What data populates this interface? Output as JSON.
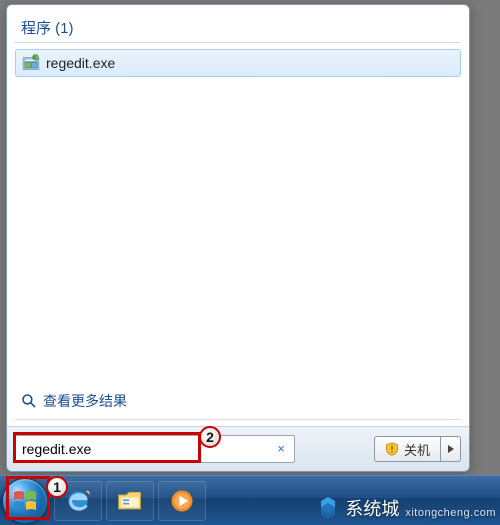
{
  "start_menu": {
    "section_header": "程序 (1)",
    "results": [
      {
        "label": "regedit.exe",
        "icon": "regedit-icon"
      }
    ],
    "see_more": "查看更多结果",
    "search_value": "regedit.exe",
    "clear_symbol": "×"
  },
  "shutdown": {
    "label": "关机"
  },
  "callouts": {
    "one": "1",
    "two": "2"
  },
  "watermark": {
    "brand": "系统城",
    "sub": "xitongcheng.com"
  }
}
